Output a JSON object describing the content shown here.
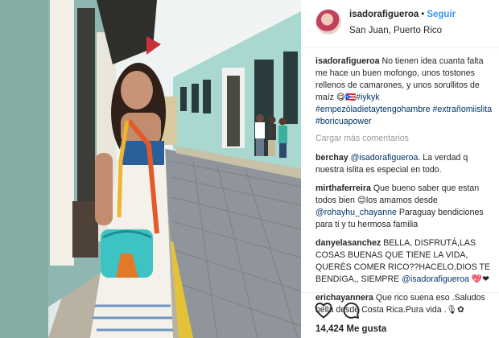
{
  "post": {
    "photo_alt": "Photo",
    "likes_text": "14,424 Me gusta"
  },
  "header": {
    "username": "isadorafigueroa",
    "separator": "•",
    "follow_label": "Seguir",
    "location": "San Juan, Puerto Rico"
  },
  "caption": {
    "username": "isadorafigueroa",
    "text": "No tienen idea cuanta falta me hace un buen mofongo, unos tostones rellenos de camarones, y unos sorullitos de maíz 😋🇵🇷",
    "hashtags": [
      "#iykyk",
      "#empezóladietaytengohambre",
      "#extrañomiislita",
      "#boricuapower"
    ]
  },
  "load_more_label": "Cargar más comentarios",
  "comments": [
    {
      "username": "berchay",
      "mention": "@isadorafigueroa",
      "text": ". La verdad q nuestra islita es especial en todo."
    },
    {
      "username": "mirthaferreira",
      "text": "Que bueno saber que estan todos bien 😊los amamos desde",
      "mention": "@rohayhu_chayanne",
      "text_after": " Paraguay bendiciones para ti y tu hermosa familia"
    },
    {
      "username": "danyelasanchez",
      "text": "BELLA, DISFRUTÁ,LAS COSAS BUENAS QUE TIENE LA VIDA, QUERÉS COMER RICO??HACELO,DIOS TE BENDIGA,, SIEMPRE",
      "mention": "@isadorafigueroa",
      "text_after": " 💖❤"
    },
    {
      "username": "erichayannera",
      "text": "Que rico suena eso .Saludos bella desde Costa Rica.Pura vida .🎙✿"
    }
  ],
  "icons": {
    "like": "heart-icon",
    "comment": "comment-bubble-icon"
  },
  "colors": {
    "follow": "#3897f0",
    "link": "#003569",
    "muted": "#999999",
    "wall_mint": "#a8d8d0"
  }
}
